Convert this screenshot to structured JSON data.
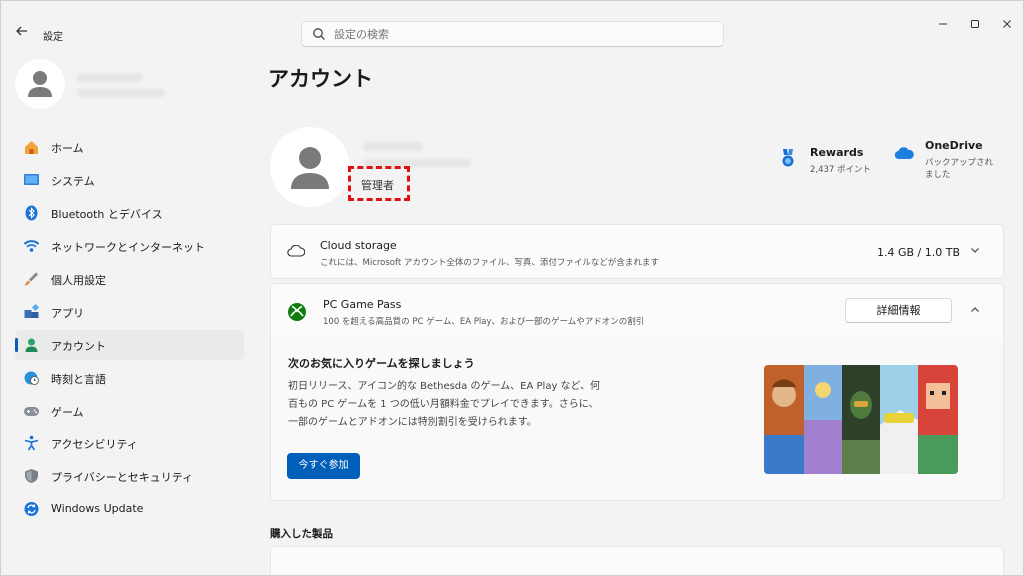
{
  "window": {
    "app_title": "設定",
    "back_icon": "back-arrow-icon",
    "controls": [
      "minimize",
      "maximize",
      "close"
    ]
  },
  "search": {
    "placeholder": "設定の検索",
    "icon": "search-icon"
  },
  "sidebar": {
    "items": [
      {
        "label": "ホーム",
        "icon": "home-icon",
        "active": false
      },
      {
        "label": "システム",
        "icon": "system-icon",
        "active": false
      },
      {
        "label": "Bluetooth とデバイス",
        "icon": "bluetooth-icon",
        "active": false
      },
      {
        "label": "ネットワークとインターネット",
        "icon": "wifi-icon",
        "active": false
      },
      {
        "label": "個人用設定",
        "icon": "brush-icon",
        "active": false
      },
      {
        "label": "アプリ",
        "icon": "apps-icon",
        "active": false
      },
      {
        "label": "アカウント",
        "icon": "account-icon",
        "active": true
      },
      {
        "label": "時刻と言語",
        "icon": "globe-clock-icon",
        "active": false
      },
      {
        "label": "ゲーム",
        "icon": "gamepad-icon",
        "active": false
      },
      {
        "label": "アクセシビリティ",
        "icon": "accessibility-icon",
        "active": false
      },
      {
        "label": "プライバシーとセキュリティ",
        "icon": "shield-icon",
        "active": false
      },
      {
        "label": "Windows Update",
        "icon": "update-icon",
        "active": false
      }
    ]
  },
  "main": {
    "title": "アカウント",
    "account_type": "管理者",
    "rewards": {
      "name": "Rewards",
      "points": "2,437 ポイント",
      "icon": "rewards-medal-icon"
    },
    "onedrive": {
      "name": "OneDrive",
      "status": "バックアップされました",
      "icon": "onedrive-cloud-icon"
    },
    "cloud_storage": {
      "title": "Cloud storage",
      "description": "これには、Microsoft アカウント全体のファイル、写真、添付ファイルなどが含まれます",
      "usage": "1.4 GB / 1.0 TB"
    },
    "game_pass": {
      "title": "PC Game Pass",
      "description": "100 を超える高品質の PC ゲーム、EA Play、および一部のゲームやアドオンの割引",
      "details_button": "詳細情報",
      "heading": "次のお気に入りゲームを探しましょう",
      "body": "初日リリース、アイコン的な Bethesda のゲーム、EA Play など、何百もの PC ゲームを 1 つの低い月額料金でプレイできます。さらに、一部のゲームとアドオンには特別割引を受けられます。",
      "join_button": "今すぐ参加"
    },
    "purchased_section": "購入した製品"
  },
  "colors": {
    "accent": "#005fb8",
    "highlight": "#e01010",
    "background": "#f3f3f3"
  }
}
